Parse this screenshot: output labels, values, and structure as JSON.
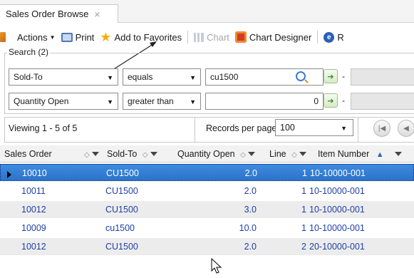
{
  "tab": {
    "title": "Sales Order Browse",
    "close": "×"
  },
  "toolbar": {
    "actions": "Actions",
    "print": "Print",
    "favorites": "Add to Favorites",
    "chart": "Chart",
    "chart_designer": "Chart Designer",
    "help_fragment": "R"
  },
  "search": {
    "legend": "Search (2)",
    "rows": [
      {
        "field": "Sold-To",
        "operator": "equals",
        "value": "cu1500",
        "dash": "-"
      },
      {
        "field": "Quantity Open",
        "operator": "greater than",
        "value": "0",
        "dash": "-"
      }
    ]
  },
  "paging": {
    "viewing": "Viewing 1 - 5 of 5",
    "records_label": "Records per page:",
    "records_value": "100"
  },
  "grid": {
    "columns": [
      "Sales Order",
      "Sold-To",
      "Quantity Open",
      "Line",
      "Item Number"
    ],
    "rows": [
      {
        "order": "10010",
        "sold_to": "CU1500",
        "qty": "2.0",
        "line": "1",
        "item": "10-10000-001"
      },
      {
        "order": "10011",
        "sold_to": "CU1500",
        "qty": "2.0",
        "line": "1",
        "item": "10-10000-001"
      },
      {
        "order": "10012",
        "sold_to": "CU1500",
        "qty": "3.0",
        "line": "1",
        "item": "10-10000-001"
      },
      {
        "order": "10009",
        "sold_to": "cu1500",
        "qty": "10.0",
        "line": "1",
        "item": "10-10000-001"
      },
      {
        "order": "10012",
        "sold_to": "CU1500",
        "qty": "2.0",
        "line": "2",
        "item": "20-10000-001"
      }
    ]
  }
}
